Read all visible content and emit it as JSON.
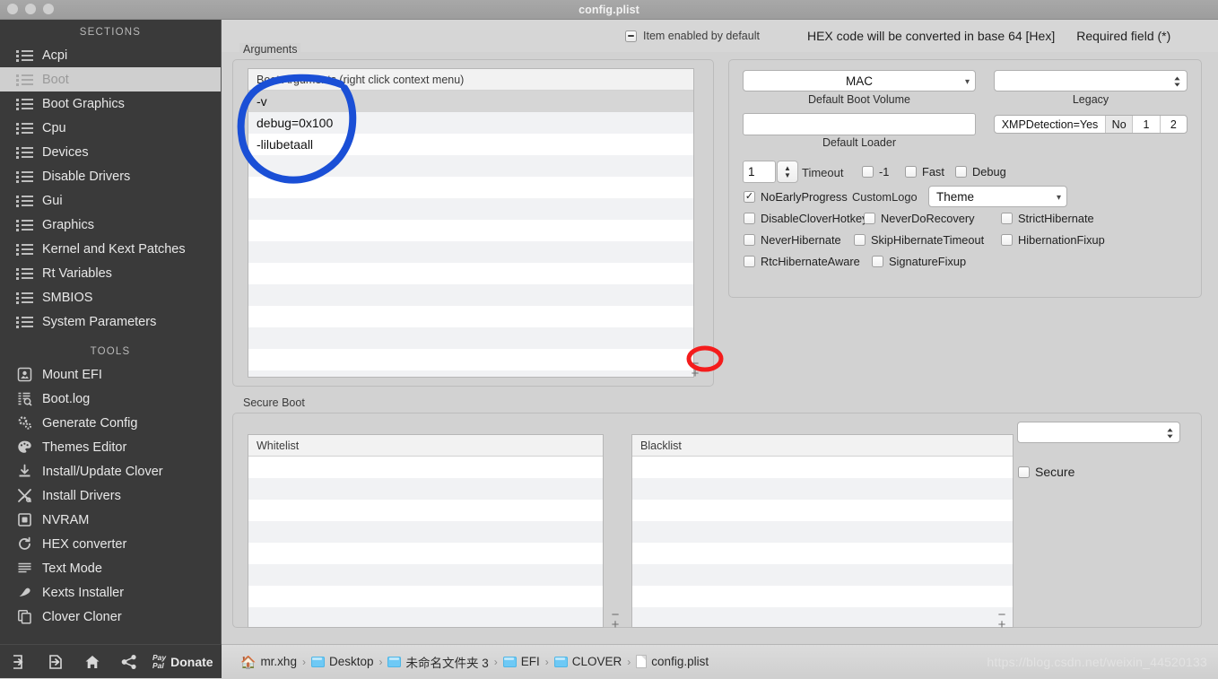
{
  "window": {
    "title": "config.plist"
  },
  "sidebar": {
    "sections_header": "SECTIONS",
    "tools_header": "TOOLS",
    "sections": [
      {
        "label": "Acpi",
        "icon": "list-icon",
        "active": false
      },
      {
        "label": "Boot",
        "icon": "list-icon",
        "active": true
      },
      {
        "label": "Boot Graphics",
        "icon": "list-icon",
        "active": false
      },
      {
        "label": "Cpu",
        "icon": "list-icon",
        "active": false
      },
      {
        "label": "Devices",
        "icon": "list-icon",
        "active": false
      },
      {
        "label": "Disable Drivers",
        "icon": "list-icon",
        "active": false
      },
      {
        "label": "Gui",
        "icon": "list-icon",
        "active": false
      },
      {
        "label": "Graphics",
        "icon": "list-icon",
        "active": false
      },
      {
        "label": "Kernel and Kext Patches",
        "icon": "list-icon",
        "active": false
      },
      {
        "label": "Rt Variables",
        "icon": "list-icon",
        "active": false
      },
      {
        "label": "SMBIOS",
        "icon": "list-icon",
        "active": false
      },
      {
        "label": "System Parameters",
        "icon": "list-icon",
        "active": false
      }
    ],
    "tools": [
      {
        "label": "Mount EFI",
        "icon": "disk-icon"
      },
      {
        "label": "Boot.log",
        "icon": "log-search-icon"
      },
      {
        "label": "Generate Config",
        "icon": "gears-icon"
      },
      {
        "label": "Themes Editor",
        "icon": "palette-icon"
      },
      {
        "label": "Install/Update Clover",
        "icon": "download-icon"
      },
      {
        "label": "Install Drivers",
        "icon": "tools-icon"
      },
      {
        "label": "NVRAM",
        "icon": "chip-icon"
      },
      {
        "label": "HEX converter",
        "icon": "refresh-icon"
      },
      {
        "label": "Text Mode",
        "icon": "text-lines-icon"
      },
      {
        "label": "Kexts Installer",
        "icon": "plug-icon"
      },
      {
        "label": "Clover Cloner",
        "icon": "copy-icon"
      }
    ],
    "footer": {
      "import_label": "import-icon",
      "export_label": "export-icon",
      "home_label": "home-icon",
      "share_label": "share-icon",
      "paypal_line1": "Pay",
      "paypal_line2": "Pal",
      "donate_label": "Donate"
    }
  },
  "topbar": {
    "item_enabled_label": "Item enabled by default",
    "hex_note": "HEX code will be converted in base 64 [Hex]",
    "required_note": "Required field (*)"
  },
  "arguments": {
    "group_title": "Arguments",
    "list_header": "Boot Arguments (right click context menu)",
    "items": [
      "-v",
      "debug=0x100",
      "-lilubetaall"
    ],
    "selected_index": 0,
    "total_rows": 14,
    "remove_label": "−",
    "add_label": "+"
  },
  "boot_options": {
    "default_boot_volume": {
      "value": "MAC",
      "caption": "Default Boot Volume"
    },
    "legacy": {
      "value": "",
      "caption": "Legacy"
    },
    "default_loader": {
      "value": "",
      "caption": "Default Loader"
    },
    "xmp": {
      "segments": [
        "XMPDetection=Yes",
        "No",
        "1",
        "2"
      ],
      "selected": 1
    },
    "timeout": {
      "value": "1",
      "label": "Timeout"
    },
    "inline_checks": [
      {
        "label": "-1",
        "checked": false
      },
      {
        "label": "Fast",
        "checked": false
      },
      {
        "label": "Debug",
        "checked": false
      }
    ],
    "no_early_progress": {
      "label": "NoEarlyProgress",
      "checked": true
    },
    "custom_logo": {
      "label": "CustomLogo",
      "value": "Theme"
    },
    "checks_row_2": [
      {
        "label": "DisableCloverHotkeys",
        "checked": false
      },
      {
        "label": "NeverDoRecovery",
        "checked": false
      },
      {
        "label": "StrictHibernate",
        "checked": false
      }
    ],
    "checks_row_3": [
      {
        "label": "NeverHibernate",
        "checked": false
      },
      {
        "label": "SkipHibernateTimeout",
        "checked": false
      },
      {
        "label": "HibernationFixup",
        "checked": false
      }
    ],
    "checks_row_4": [
      {
        "label": "RtcHibernateAware",
        "checked": false
      },
      {
        "label": "SignatureFixup",
        "checked": false
      }
    ]
  },
  "secure_boot": {
    "group_title": "Secure Boot",
    "whitelist": {
      "header": "Whitelist",
      "items": [],
      "rows": 8
    },
    "blacklist": {
      "header": "Blacklist",
      "items": [],
      "rows": 8
    },
    "policy": {
      "value": ""
    },
    "secure": {
      "label": "Secure",
      "checked": false
    },
    "remove_label": "−",
    "add_label": "+"
  },
  "statusbar": {
    "breadcrumb": [
      {
        "label": "mr.xhg",
        "icon": "home-icon"
      },
      {
        "label": "Desktop",
        "icon": "folder-icon"
      },
      {
        "label": "未命名文件夹 3",
        "icon": "folder-icon"
      },
      {
        "label": "EFI",
        "icon": "folder-icon"
      },
      {
        "label": "CLOVER",
        "icon": "folder-icon"
      },
      {
        "label": "config.plist",
        "icon": "document-icon"
      }
    ],
    "separator": "›",
    "watermark": "https://blog.csdn.net/weixin_44520133"
  },
  "annotations": {
    "blue_circle_color": "#1a4fd6",
    "red_circle_color": "#f41c1c"
  }
}
